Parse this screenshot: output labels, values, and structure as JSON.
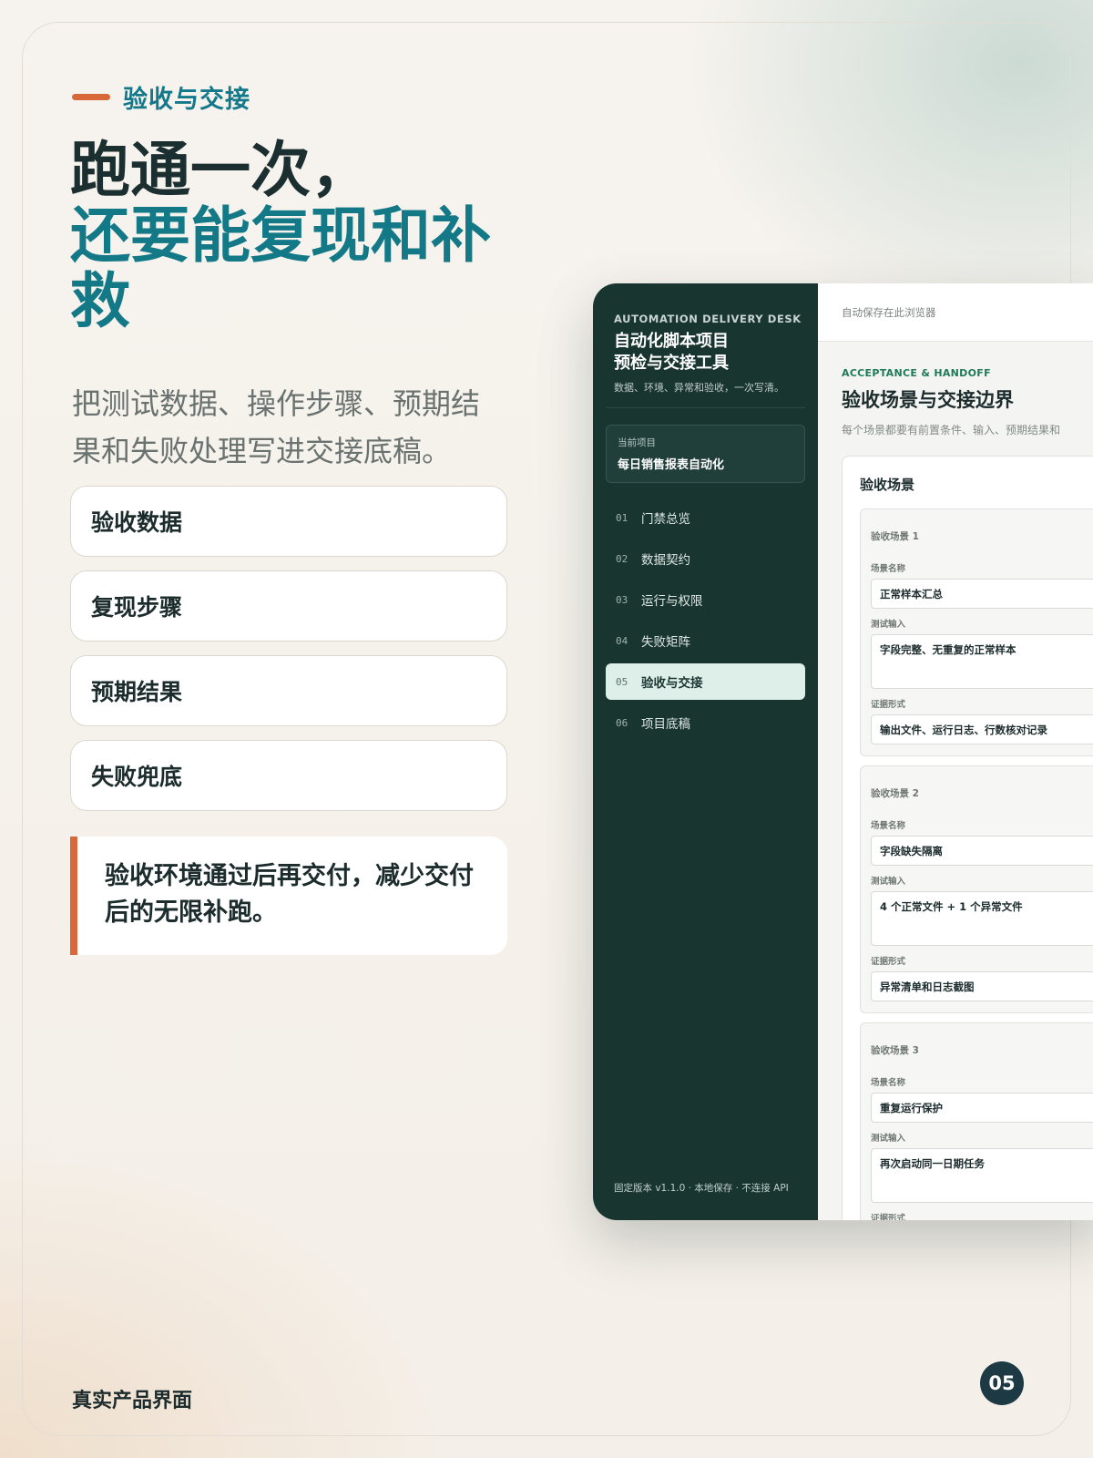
{
  "eyebrow": "验收与交接",
  "headline": {
    "line1": "跑通一次，",
    "line2": "还要能复现和补救"
  },
  "subtitle": "把测试数据、操作步骤、预期结果和失败处理写进交接底稿。",
  "pills": [
    "验收数据",
    "复现步骤",
    "预期结果",
    "失败兜底"
  ],
  "callout": "验收环境通过后再交付，减少交付后的无限补跑。",
  "footer": {
    "label": "真实产品界面",
    "page": "05"
  },
  "colors": {
    "accent": "#d8683a",
    "teal": "#137987",
    "sidebar": "#193530",
    "badge": "#1d3944"
  },
  "app": {
    "sidebar": {
      "eyebrow": "AUTOMATION DELIVERY DESK",
      "title_line1": "自动化脚本项目",
      "title_line2": "预检与交接工具",
      "desc": "数据、环境、异常和验收，一次写清。",
      "project_label": "当前项目",
      "project_value": "每日销售报表自动化",
      "nav": [
        {
          "num": "01",
          "label": "门禁总览",
          "active": false
        },
        {
          "num": "02",
          "label": "数据契约",
          "active": false
        },
        {
          "num": "03",
          "label": "运行与权限",
          "active": false
        },
        {
          "num": "04",
          "label": "失败矩阵",
          "active": false
        },
        {
          "num": "05",
          "label": "验收与交接",
          "active": true
        },
        {
          "num": "06",
          "label": "项目底稿",
          "active": false
        }
      ],
      "footer": "固定版本 v1.1.0 · 本地保存 · 不连接 API"
    },
    "topbar": "自动保存在此浏览器",
    "section": {
      "eyebrow": "ACCEPTANCE & HANDOFF",
      "title": "验收场景与交接边界",
      "desc": "每个场景都要有前置条件、输入、预期结果和"
    },
    "panel_title": "验收场景",
    "field_labels": {
      "name": "场景名称",
      "input": "测试输入",
      "evidence": "证据形式"
    },
    "scenarios": [
      {
        "head": "验收场景 1",
        "name": "正常样本汇总",
        "input": "字段完整、无重复的正常样本",
        "evidence": "输出文件、运行日志、行数核对记录"
      },
      {
        "head": "验收场景 2",
        "name": "字段缺失隔离",
        "input": "4 个正常文件 + 1 个异常文件",
        "evidence": "异常清单和日志截图"
      },
      {
        "head": "验收场景 3",
        "name": "重复运行保护",
        "input": "再次启动同一日期任务",
        "evidence": ""
      }
    ]
  }
}
